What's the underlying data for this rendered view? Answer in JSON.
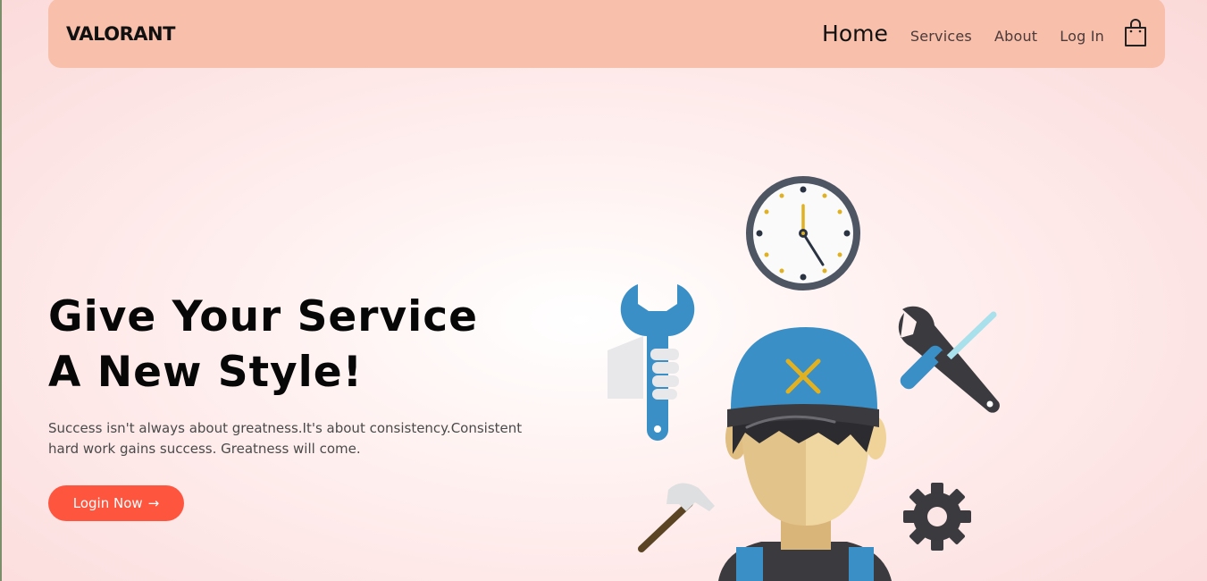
{
  "brand": {
    "logo_text": "VALORANT"
  },
  "nav": {
    "items": [
      {
        "label": "Home",
        "active": true
      },
      {
        "label": "Services",
        "active": false
      },
      {
        "label": "About",
        "active": false
      },
      {
        "label": "Log In",
        "active": false
      }
    ],
    "cart_icon": "shopping-bag-icon"
  },
  "hero": {
    "title_line1": "Give Your Service",
    "title_line2": "A New Style!",
    "description": "Success isn't always about greatness.It's about consistency.Consistent hard work gains success. Greatness will come.",
    "cta_label": "Login Now",
    "cta_icon": "→"
  },
  "colors": {
    "navbar_bg": "#f8bfaa",
    "accent": "#fe553f",
    "cap_blue": "#3a8fc6"
  }
}
